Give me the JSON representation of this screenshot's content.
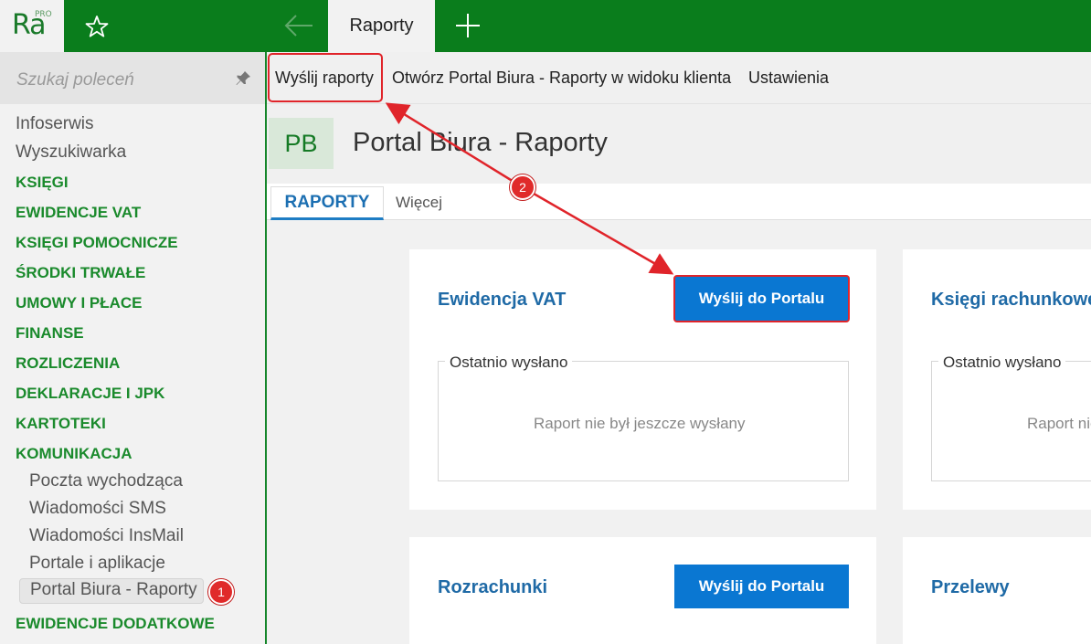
{
  "app": {
    "logo_text": "Ra",
    "logo_badge": "PRO",
    "active_tab": "Raporty"
  },
  "sidebar": {
    "search_placeholder": "Szukaj poleceń",
    "items": [
      {
        "label": "Infoserwis",
        "kind": "plain"
      },
      {
        "label": "Wyszukiwarka",
        "kind": "plain"
      },
      {
        "label": "KSIĘGI",
        "kind": "category"
      },
      {
        "label": "EWIDENCJE VAT",
        "kind": "category"
      },
      {
        "label": "KSIĘGI POMOCNICZE",
        "kind": "category"
      },
      {
        "label": "ŚRODKI TRWAŁE",
        "kind": "category"
      },
      {
        "label": "UMOWY I PŁACE",
        "kind": "category"
      },
      {
        "label": "FINANSE",
        "kind": "category"
      },
      {
        "label": "ROZLICZENIA",
        "kind": "category"
      },
      {
        "label": "DEKLARACJE I JPK",
        "kind": "category"
      },
      {
        "label": "KARTOTEKI",
        "kind": "category"
      },
      {
        "label": "KOMUNIKACJA",
        "kind": "category"
      },
      {
        "label": "Poczta wychodząca",
        "kind": "sub"
      },
      {
        "label": "Wiadomości SMS",
        "kind": "sub"
      },
      {
        "label": "Wiadomości InsMail",
        "kind": "sub"
      },
      {
        "label": "Portale i aplikacje",
        "kind": "sub"
      },
      {
        "label": "Portal Biura - Raporty",
        "kind": "sub-active"
      },
      {
        "label": "EWIDENCJE DODATKOWE",
        "kind": "category"
      }
    ]
  },
  "commands": {
    "send_reports": "Wyślij raporty",
    "open_portal": "Otwórz Portal Biura - Raporty w widoku klienta",
    "settings": "Ustawienia"
  },
  "page": {
    "badge": "PB",
    "title": "Portal Biura - Raporty"
  },
  "tabs": {
    "reports": "RAPORTY",
    "more": "Więcej"
  },
  "cards": [
    {
      "title": "Ewidencja VAT",
      "button": "Wyślij do Portalu",
      "last_sent_label": "Ostatnio wysłano",
      "empty": "Raport nie był jeszcze wysłany"
    },
    {
      "title": "Księgi rachunkowe",
      "last_sent_label": "Ostatnio wysłano",
      "empty": "Raport nie był jeszcze wysłany"
    },
    {
      "title": "Rozrachunki",
      "button": "Wyślij do Portalu"
    },
    {
      "title": "Przelewy"
    }
  ],
  "annotations": {
    "step1": "1",
    "step2": "2"
  },
  "colors": {
    "brand_green": "#0a7d1c",
    "category_green": "#1a8a2c",
    "button_blue": "#0a77d2",
    "title_blue": "#1f6aa6",
    "highlight_red": "#e0242a"
  }
}
